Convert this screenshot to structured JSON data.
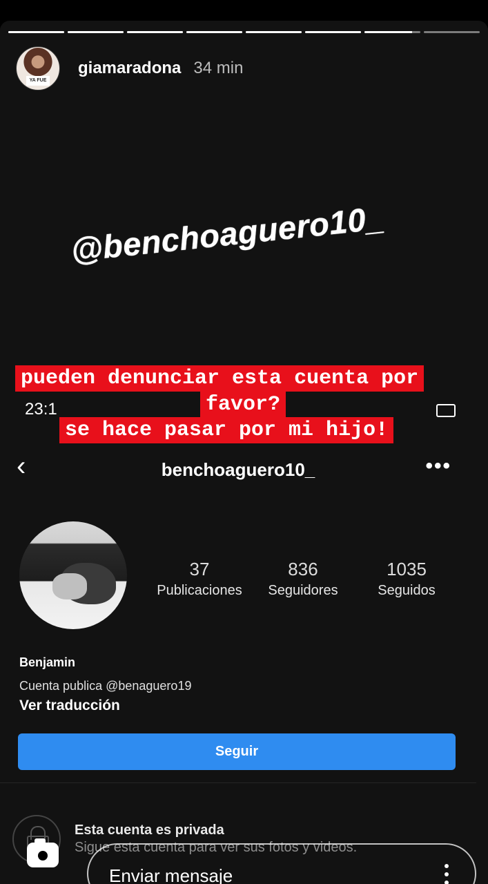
{
  "story": {
    "progress_segments": [
      1,
      1,
      1,
      1,
      1,
      1,
      0.85,
      0
    ],
    "username": "giamaradona",
    "time_ago": "34 min",
    "mention": "@benchoaguero10_",
    "stickers": [
      "pueden denunciar esta cuenta por",
      "favor?",
      "se hace pasar por mi hijo!"
    ],
    "reply_placeholder": "Enviar mensaje"
  },
  "screenshot": {
    "status_time": "23:1",
    "profile_username": "benchoaguero10_",
    "stats": [
      {
        "num": "37",
        "label": "Publicaciones"
      },
      {
        "num": "836",
        "label": "Seguidores"
      },
      {
        "num": "1035",
        "label": "Seguidos"
      }
    ],
    "bio_name": "Benjamin",
    "bio_line": "Cuenta publica @benaguero19",
    "translate": "Ver traducción",
    "follow_label": "Seguir",
    "private_title": "Esta cuenta es privada",
    "private_sub": "Sigue esta cuenta para ver sus fotos y videos."
  },
  "colors": {
    "follow_button": "#2f8cf0",
    "sticker_bg": "#e8101b"
  },
  "icons": [
    "back-chevron-icon",
    "more-options-icon",
    "lock-icon",
    "camera-icon",
    "vertical-dots-icon"
  ]
}
